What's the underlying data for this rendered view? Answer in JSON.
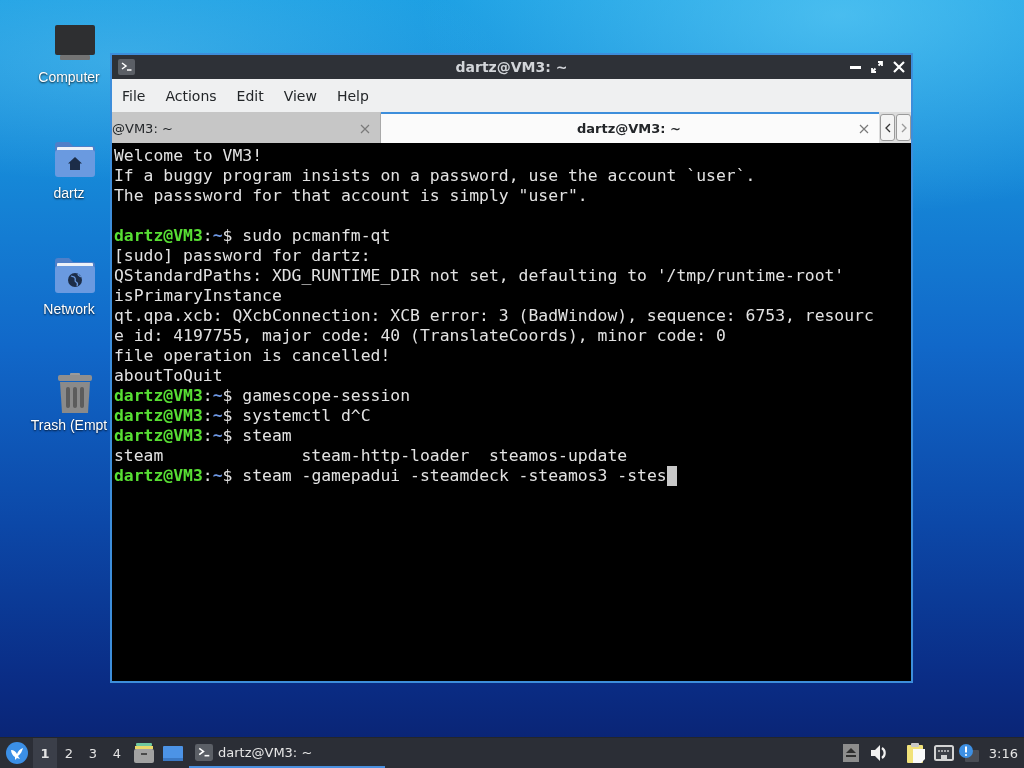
{
  "desktop": {
    "icons": [
      {
        "kind": "computer",
        "label": "Computer"
      },
      {
        "kind": "home",
        "label": "dartz"
      },
      {
        "kind": "network",
        "label": "Network"
      },
      {
        "kind": "trash",
        "label": "Trash (Empt"
      }
    ]
  },
  "window": {
    "title": "dartz@VM3: ~",
    "menu": [
      "File",
      "Actions",
      "Edit",
      "View",
      "Help"
    ],
    "tabs": [
      {
        "label": "@VM3: ~",
        "selected": false
      },
      {
        "label": "dartz@VM3: ~",
        "selected": true
      }
    ],
    "terminal": {
      "lines": [
        {
          "kind": "output",
          "text": "Welcome to VM3!"
        },
        {
          "kind": "output",
          "text": "If a buggy program insists on a password, use the account `user`."
        },
        {
          "kind": "output",
          "text": "The passsword for that account is simply \"user\"."
        },
        {
          "kind": "blank"
        },
        {
          "kind": "prompt",
          "user_host": "dartz@VM3",
          "separator": ":",
          "path": "~",
          "symbol": "$",
          "command": "sudo pcmanfm-qt"
        },
        {
          "kind": "output",
          "text": "[sudo] password for dartz:"
        },
        {
          "kind": "output",
          "text": "QStandardPaths: XDG_RUNTIME_DIR not set, defaulting to '/tmp/runtime-root'"
        },
        {
          "kind": "output",
          "text": "isPrimaryInstance"
        },
        {
          "kind": "output",
          "text": "qt.qpa.xcb: QXcbConnection: XCB error: 3 (BadWindow), sequence: 6753, resourc"
        },
        {
          "kind": "output",
          "text": "e id: 4197755, major code: 40 (TranslateCoords), minor code: 0"
        },
        {
          "kind": "output",
          "text": "file operation is cancelled!"
        },
        {
          "kind": "output",
          "text": "aboutToQuit"
        },
        {
          "kind": "prompt",
          "user_host": "dartz@VM3",
          "separator": ":",
          "path": "~",
          "symbol": "$",
          "command": "gamescope-session"
        },
        {
          "kind": "prompt",
          "user_host": "dartz@VM3",
          "separator": ":",
          "path": "~",
          "symbol": "$",
          "command": "systemctl d^C"
        },
        {
          "kind": "prompt",
          "user_host": "dartz@VM3",
          "separator": ":",
          "path": "~",
          "symbol": "$",
          "command": "steam"
        },
        {
          "kind": "output",
          "text": "steam              steam-http-loader  steamos-update"
        },
        {
          "kind": "prompt",
          "user_host": "dartz@VM3",
          "separator": ":",
          "path": "~",
          "symbol": "$",
          "command": "steam -gamepadui -steamdeck -steamos3 -stes"
        }
      ],
      "cursor": true
    }
  },
  "taskbar": {
    "workspaces": [
      {
        "label": "1",
        "selected": true
      },
      {
        "label": "2",
        "selected": false
      },
      {
        "label": "3",
        "selected": false
      },
      {
        "label": "4",
        "selected": false
      }
    ],
    "tasks": [
      {
        "label": "dartz@VM3: ~",
        "selected": true
      }
    ],
    "clock": "3:16"
  }
}
